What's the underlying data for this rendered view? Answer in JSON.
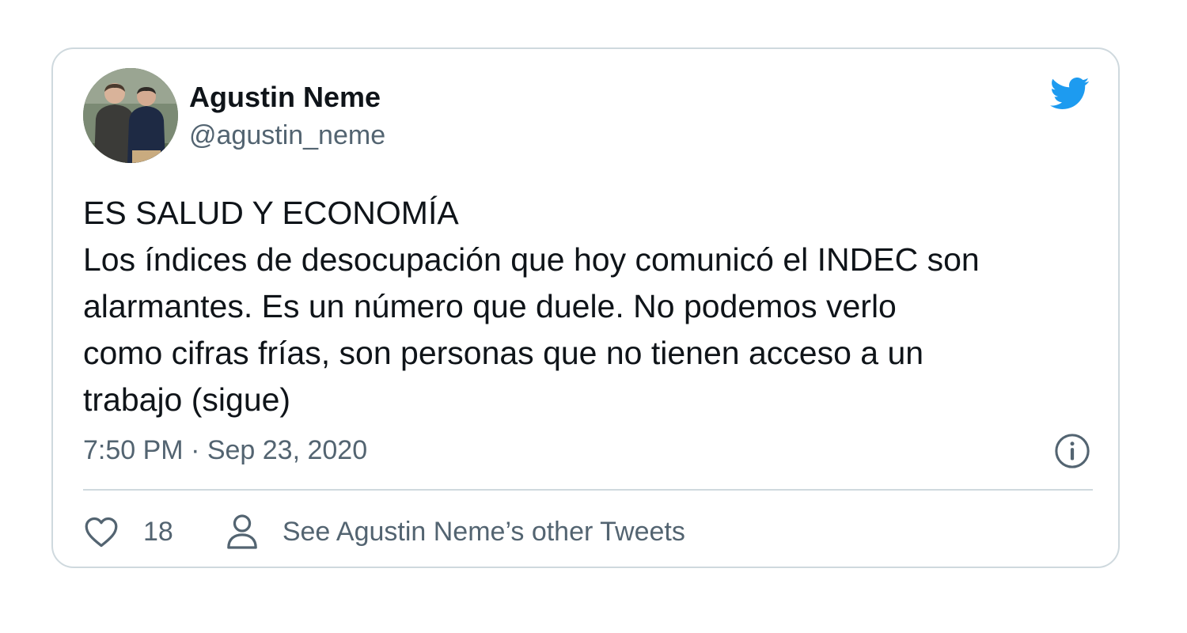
{
  "tweet": {
    "author_name": "Agustin Neme",
    "author_handle": "@agustin_neme",
    "text_lines": [
      "ES SALUD Y ECONOMÍA",
      "Los índices de desocupación que hoy comunicó el INDEC son",
      "alarmantes. Es un número que duele. No podemos verlo",
      "como cifras frías, son personas que no tienen acceso a un",
      "trabajo (sigue)"
    ],
    "timestamp": "7:50 PM · Sep 23, 2020",
    "like_count": "18",
    "other_tweets_label": "See Agustin Neme’s other Tweets"
  },
  "icons": {
    "brand": "twitter-bird-icon",
    "info": "info-icon",
    "like": "heart-icon",
    "profile": "person-icon"
  },
  "colors": {
    "brand_blue": "#1d9bf0",
    "text_primary": "#0f1419",
    "text_secondary": "#536471",
    "border": "#cfd9de"
  }
}
